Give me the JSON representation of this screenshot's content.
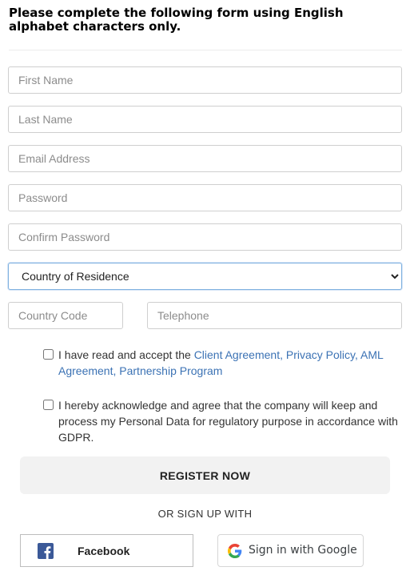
{
  "form": {
    "heading": "Please complete the following form using English alphabet characters only.",
    "first_name_placeholder": "First Name",
    "last_name_placeholder": "Last Name",
    "email_placeholder": "Email Address",
    "password_placeholder": "Password",
    "confirm_password_placeholder": "Confirm Password",
    "country_select_value": "Country of Residence",
    "country_code_placeholder": "Country Code",
    "telephone_placeholder": "Telephone"
  },
  "consent": {
    "agreement_prefix": "I have read and accept the ",
    "client_agreement": "Client Agreement",
    "sep1": ", ",
    "privacy_policy": "Privacy Policy",
    "sep2": ", ",
    "aml_agreement": "AML Agreement",
    "sep3": ", ",
    "partnership_program": "Partnership Program",
    "gdpr_text": "I hereby acknowledge and agree that the company will keep and process my Personal Data for regulatory purpose in accordance with GDPR."
  },
  "actions": {
    "register_label": "REGISTER NOW",
    "or_label": "OR SIGN UP WITH",
    "facebook_label": "Facebook",
    "google_label": "Sign in with Google"
  },
  "colors": {
    "link": "#3b72b4",
    "facebook": "#3b5998",
    "select_focus_border": "#7fb1e0"
  }
}
